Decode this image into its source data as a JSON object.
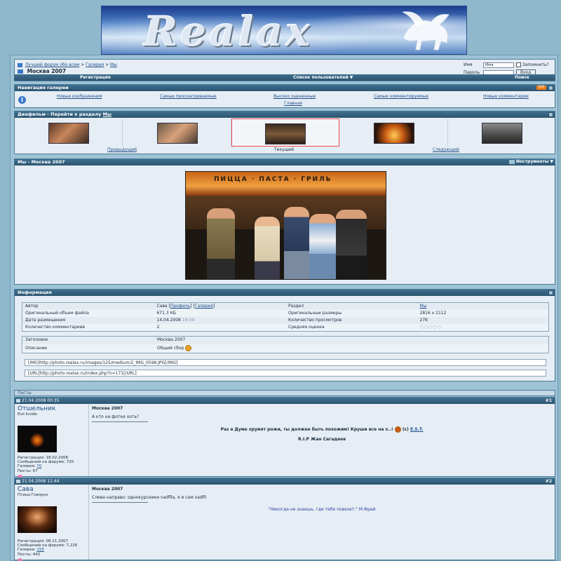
{
  "banner": {
    "logo_text": "Realax"
  },
  "nav": {
    "breadcrumb": [
      "Лучший форум обо всем",
      "Галерея",
      "Мы"
    ],
    "page_title": "Москва 2007",
    "login": {
      "user_label": "Имя",
      "user_value": "Имя",
      "remember_label": "Запомнить?",
      "pass_label": "Пароль",
      "login_button": "Вход"
    },
    "bar": {
      "register": "Регистрация",
      "members": "Список пользователей ▼",
      "search": "Поиск"
    }
  },
  "gallery_nav": {
    "title": "Навигация галереи",
    "rss": "RSS",
    "links": [
      "Новые изображения",
      "Самые просматриваемые",
      "Высоко оцененные",
      "Самые комментируемые",
      "Новые комментарии"
    ],
    "home": "Главная"
  },
  "slideshow": {
    "title": "Диафильм - Перейти к разделу",
    "section": "Мы",
    "prev": "Предыдущий",
    "current": "Текущий",
    "next": "Следующий"
  },
  "photo": {
    "title": "Мы - Москва 2007",
    "tools": "Инструменты ▼",
    "sign_text": "ПИЦЦА · ПАСТА · ГРИЛЬ"
  },
  "info": {
    "title": "Информация",
    "rows": [
      {
        "k1": "Автор",
        "v1": "Сава",
        "v1_links": [
          "Профиль",
          "Галерея"
        ],
        "k2": "Раздел",
        "v2": "Мы"
      },
      {
        "k1": "Оригинальный объем файла",
        "v1": "671.3 КБ",
        "k2": "Оригинальные размеры",
        "v2": "2816 x 2112"
      },
      {
        "k1": "Дата размещения",
        "v1": "14.04.2008",
        "v1_time": "19:59",
        "k2": "Количество просмотров",
        "v2": "276"
      },
      {
        "k1": "Количество комментариев",
        "v1": "2",
        "k2": "Средняя оценка",
        "v2": "○○○○○"
      }
    ],
    "meta": [
      {
        "k": "Заголовок",
        "v": "Москва 2007"
      },
      {
        "k": "Описание",
        "v": "Общий сбор"
      }
    ],
    "code_img": "[IMG]http://photo.realax.ru/images/125/medium/2_IMG_0598.JPG[/IMG]",
    "code_url": "[URL]http://photo.realax.ru/index.php?n=171[/URL]"
  },
  "posts_label": "Посты",
  "posts": [
    {
      "date": "21.04.2008 00:35",
      "num": "#1",
      "username": "Отшельник",
      "usertitle": "Evil Inside",
      "reg": "Регистрация: 18.02.2008",
      "forum_posts": "Сообщений на форуме: 720",
      "gallery_label": "Галерея:",
      "gallery_count": "70",
      "posts_count": "Посты: 67",
      "title": "Москва 2007",
      "text": "А кто на фотке хоть?",
      "sig_line": "Раз в Думе хрумят рожи, ты должен быть похожим! Круши все на х..!",
      "sig_copy": "(c)",
      "sig_author": "E.S.T.",
      "sig_line2": "R.I.P Жан Сагадеев"
    },
    {
      "date": "21.04.2008 11:44",
      "num": "#2",
      "username": "Сава",
      "usertitle": "Птица Говорун",
      "reg": "Регистрация: 08.11.2007",
      "forum_posts": "Сообщений на форуме: 7,226",
      "gallery_label": "Галерея:",
      "gallery_count": "155",
      "posts_count": "Посты: 443",
      "title": "Москва 2007",
      "text": "Слева направо: однокурсники vadflla, я и сам vadfil",
      "sig_quote": "\"Никогда не знаешь, где тебе повезет.\" М.Фрай"
    }
  ],
  "colors": {
    "bar": "#2c5570",
    "bg": "#8fb8cc",
    "link": "#1d4e8a",
    "accent_current": "#e85050"
  }
}
